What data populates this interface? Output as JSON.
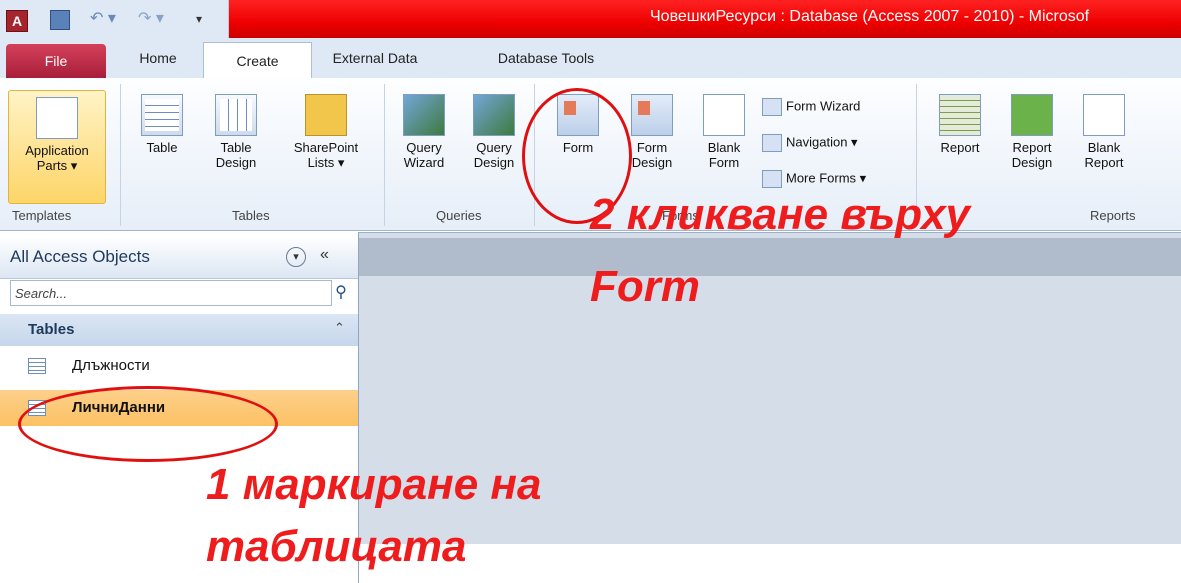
{
  "window": {
    "title": "ЧовешкиРесурси : Database (Access 2007 - 2010)  -  Microsof",
    "app_icon_letter": "A"
  },
  "tabs": {
    "file": "File",
    "home": "Home",
    "create": "Create",
    "external": "External Data",
    "dbtools": "Database Tools"
  },
  "ribbon": {
    "templates": {
      "label": "Templates",
      "app_parts": "Application Parts ▾"
    },
    "tables": {
      "label": "Tables",
      "table": "Table",
      "table_design": "Table Design",
      "sharepoint": "SharePoint Lists ▾"
    },
    "queries": {
      "label": "Queries",
      "query_wizard": "Query Wizard",
      "query_design": "Query Design"
    },
    "forms": {
      "label": "Forms",
      "form": "Form",
      "form_design": "Form Design",
      "blank_form": "Blank Form",
      "form_wizard": "Form Wizard",
      "navigation": "Navigation ▾",
      "more_forms": "More Forms ▾"
    },
    "reports": {
      "label": "Reports",
      "report": "Report",
      "report_design": "Report Design",
      "blank_report": "Blank Report"
    }
  },
  "nav_pane": {
    "title": "All Access Objects",
    "search_placeholder": "Search...",
    "group": "Tables",
    "items": [
      {
        "label": "Длъжности",
        "selected": false
      },
      {
        "label": "ЛичниДанни",
        "selected": true
      }
    ]
  },
  "annotations": {
    "step2_line1": "2 кликване върху",
    "step2_line2": "Form",
    "step1_line1": "1 маркиране на",
    "step1_line2": "таблицата",
    "color": "#ee1c1c"
  }
}
